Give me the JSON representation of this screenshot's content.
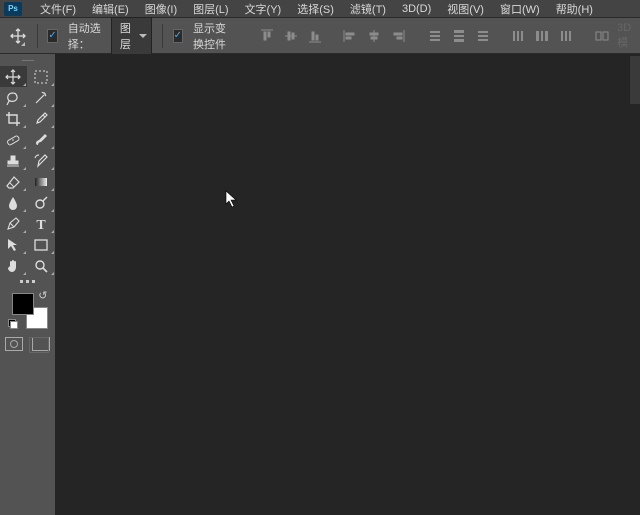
{
  "app": {
    "logo": "Ps"
  },
  "menu": {
    "items": [
      "文件(F)",
      "编辑(E)",
      "图像(I)",
      "图层(L)",
      "文字(Y)",
      "选择(S)",
      "滤镜(T)",
      "3D(D)",
      "视图(V)",
      "窗口(W)",
      "帮助(H)"
    ]
  },
  "options": {
    "auto_select_label": "自动选择：",
    "auto_select_value": "图层",
    "show_transform_label": "显示变换控件",
    "dimmed_right": "3D 模"
  },
  "toolbar": {
    "tools": [
      {
        "name": "move-tool",
        "glyph": "move",
        "active": true
      },
      {
        "name": "artboard-tool",
        "glyph": "marquee-dash"
      },
      {
        "name": "lasso-tool",
        "glyph": "lasso"
      },
      {
        "name": "magic-wand-tool",
        "glyph": "wand"
      },
      {
        "name": "crop-tool",
        "glyph": "crop"
      },
      {
        "name": "eyedropper-tool",
        "glyph": "eyedropper"
      },
      {
        "name": "healing-brush-tool",
        "glyph": "bandage"
      },
      {
        "name": "brush-tool",
        "glyph": "brush"
      },
      {
        "name": "clone-stamp-tool",
        "glyph": "stamp"
      },
      {
        "name": "history-brush-tool",
        "glyph": "history-brush"
      },
      {
        "name": "eraser-tool",
        "glyph": "eraser"
      },
      {
        "name": "gradient-tool",
        "glyph": "gradient"
      },
      {
        "name": "blur-tool",
        "glyph": "drop"
      },
      {
        "name": "dodge-tool",
        "glyph": "dodge"
      },
      {
        "name": "pen-tool",
        "glyph": "pen"
      },
      {
        "name": "type-tool",
        "glyph": "T"
      },
      {
        "name": "path-select-tool",
        "glyph": "arrow"
      },
      {
        "name": "rectangle-tool",
        "glyph": "rect"
      },
      {
        "name": "hand-tool",
        "glyph": "hand"
      },
      {
        "name": "zoom-tool",
        "glyph": "zoom"
      }
    ]
  },
  "colors": {
    "bg": "#535353",
    "panel": "#3a3a3a",
    "canvas": "#252525",
    "accent": "#4fa9e8"
  }
}
